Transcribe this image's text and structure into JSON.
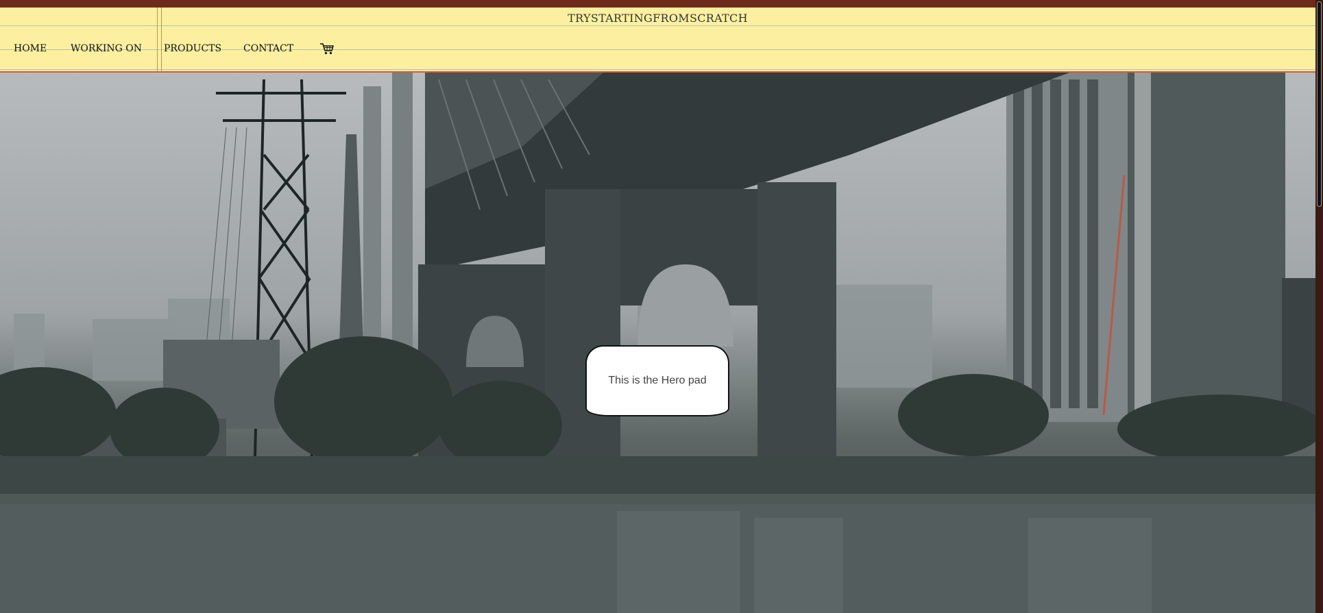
{
  "site": {
    "title": "TRYSTARTINGFROMSCRATCH"
  },
  "nav": {
    "items": [
      {
        "label": "HOME"
      },
      {
        "label": "WORKING ON"
      },
      {
        "label": "PRODUCTS"
      },
      {
        "label": "CONTACT"
      }
    ],
    "cart_icon": "shopping-cart-icon"
  },
  "hero": {
    "pad_text": "This is the Hero pad",
    "image": "foggy-bridge-over-river-icon"
  },
  "colors": {
    "topbar": "#6e2b1c",
    "header_bg": "#fcf0a0",
    "header_border": "#d9583f",
    "rule_lines": "#9ab6b3"
  }
}
